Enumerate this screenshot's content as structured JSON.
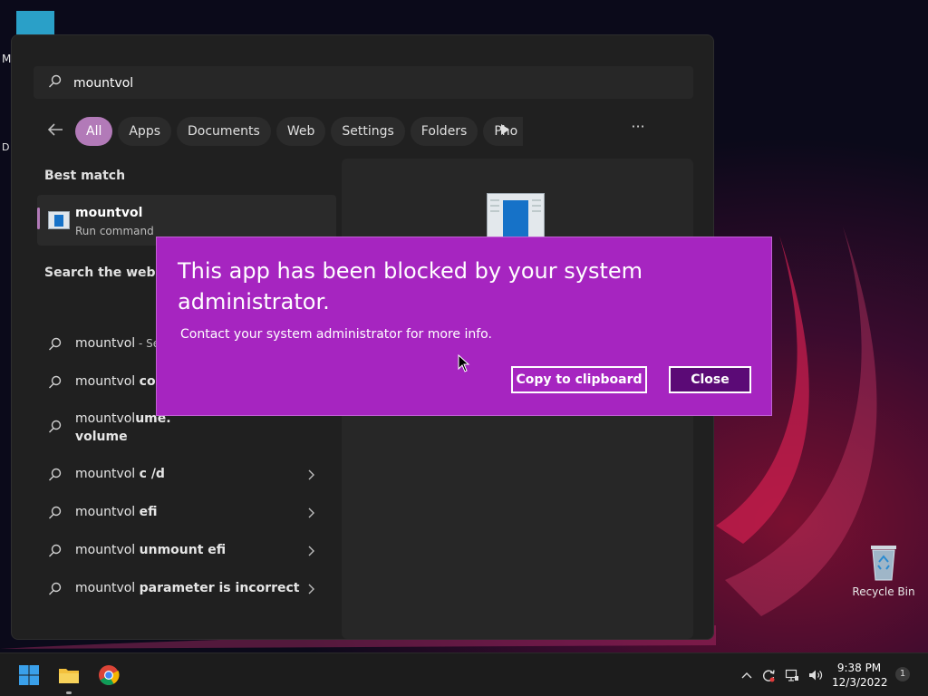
{
  "desktop": {
    "recycle_bin_label": "Recycle Bin",
    "partial_label_top": "M",
    "partial_label_mid": "D"
  },
  "search": {
    "query": "mountvol",
    "tabs": [
      {
        "label": "All",
        "active": true
      },
      {
        "label": "Apps"
      },
      {
        "label": "Documents"
      },
      {
        "label": "Web"
      },
      {
        "label": "Settings"
      },
      {
        "label": "Folders"
      },
      {
        "label": "Pho"
      }
    ],
    "best_match_title": "Best match",
    "best_match": {
      "name": "mountvol",
      "subtitle": "Run command"
    },
    "web_title": "Search the web",
    "web_results": [
      {
        "prefix": "mountvol",
        "bold": "",
        "suffix": " - See"
      },
      {
        "prefix": "mountvol ",
        "bold": "com",
        "suffix": ""
      },
      {
        "prefix": "mountvol",
        "bold": "ume.",
        "line2": "volume"
      },
      {
        "prefix": "mountvol ",
        "bold": "c /d",
        "suffix": ""
      },
      {
        "prefix": "mountvol ",
        "bold": "efi",
        "suffix": ""
      },
      {
        "prefix": "mountvol ",
        "bold": "unmount efi",
        "suffix": ""
      },
      {
        "prefix": "mountvol ",
        "bold": "parameter is incorrect",
        "suffix": ""
      }
    ]
  },
  "dialog": {
    "title": "This app has been blocked by your system administrator.",
    "message": "Contact your system administrator for more info.",
    "copy_button": "Copy to clipboard",
    "close_button": "Close"
  },
  "taskbar": {
    "time": "9:38 PM",
    "date": "12/3/2022",
    "notification_count": "1"
  },
  "colors": {
    "dialog_bg": "#a625c0",
    "close_btn_bg": "#5b0a76",
    "accent": "#b27ab8"
  }
}
